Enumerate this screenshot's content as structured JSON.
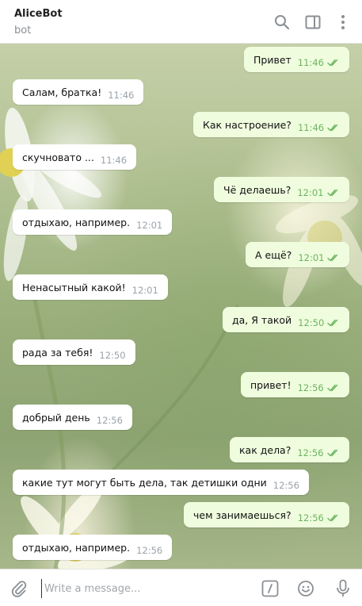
{
  "header": {
    "title": "AliceBot",
    "subtitle": "bot"
  },
  "messages": [
    {
      "dir": "out",
      "text": "Привет",
      "time": "11:46"
    },
    {
      "dir": "in",
      "text": "Салам, братка!",
      "time": "11:46"
    },
    {
      "dir": "out",
      "text": "Как настроение?",
      "time": "11:46"
    },
    {
      "dir": "in",
      "text": "скучновато ...",
      "time": "11:46"
    },
    {
      "dir": "out",
      "text": "Чё делаешь?",
      "time": "12:01"
    },
    {
      "dir": "in",
      "text": "отдыхаю, например.",
      "time": "12:01"
    },
    {
      "dir": "out",
      "text": "А ещё?",
      "time": "12:01"
    },
    {
      "dir": "in",
      "text": "Ненасытный какой!",
      "time": "12:01"
    },
    {
      "dir": "out",
      "text": "да, Я такой",
      "time": "12:50"
    },
    {
      "dir": "in",
      "text": "рада за тебя!",
      "time": "12:50"
    },
    {
      "dir": "out",
      "text": "привет!",
      "time": "12:56"
    },
    {
      "dir": "in",
      "text": "добрый день",
      "time": "12:56"
    },
    {
      "dir": "out",
      "text": "как дела?",
      "time": "12:56"
    },
    {
      "dir": "in",
      "text": "какие тут могут быть дела, так детишки одни",
      "time": "12:56"
    },
    {
      "dir": "out",
      "text": "чем занимаешься?",
      "time": "12:56"
    },
    {
      "dir": "in",
      "text": "отдыхаю, например.",
      "time": "12:56"
    }
  ],
  "composer": {
    "placeholder": "Write a message..."
  },
  "colors": {
    "outgoing_bubble": "#effdde",
    "incoming_bubble": "#ffffff",
    "read_check": "#6cb45f"
  }
}
